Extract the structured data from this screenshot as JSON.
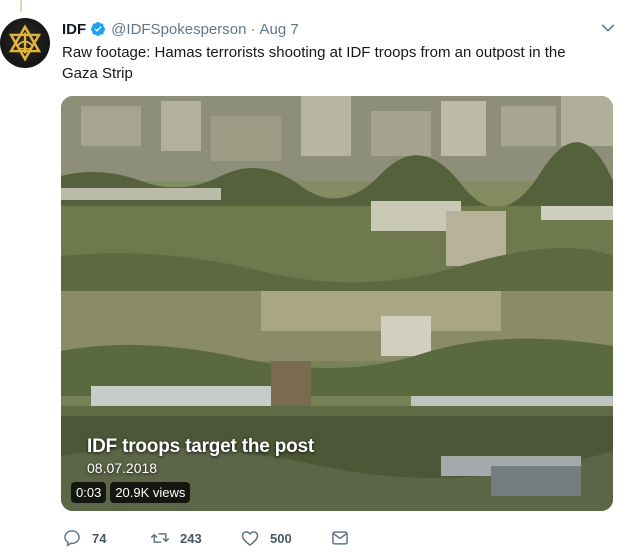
{
  "tweet": {
    "author_name": "IDF",
    "handle": "@IDFSpokesperson",
    "separator": "·",
    "date": "Aug 7",
    "text": "Raw footage: Hamas terrorists shooting at IDF troops from an outpost in the Gaza Strip"
  },
  "media": {
    "overlay_title": "IDF troops target the post",
    "overlay_date": "08.07.2018",
    "duration": "0:03",
    "views": "20.9K views"
  },
  "actions": {
    "replies": "74",
    "retweets": "243",
    "likes": "500"
  },
  "icons": {
    "avatar": "idf-emblem-icon",
    "verified": "verified-badge-icon",
    "more": "chevron-down-icon",
    "reply": "reply-icon",
    "retweet": "retweet-icon",
    "like": "heart-icon",
    "message": "direct-message-icon"
  },
  "colors": {
    "verified_blue": "#1da1f2",
    "secondary_text": "#657786",
    "emblem_gold": "#e0b53a"
  }
}
